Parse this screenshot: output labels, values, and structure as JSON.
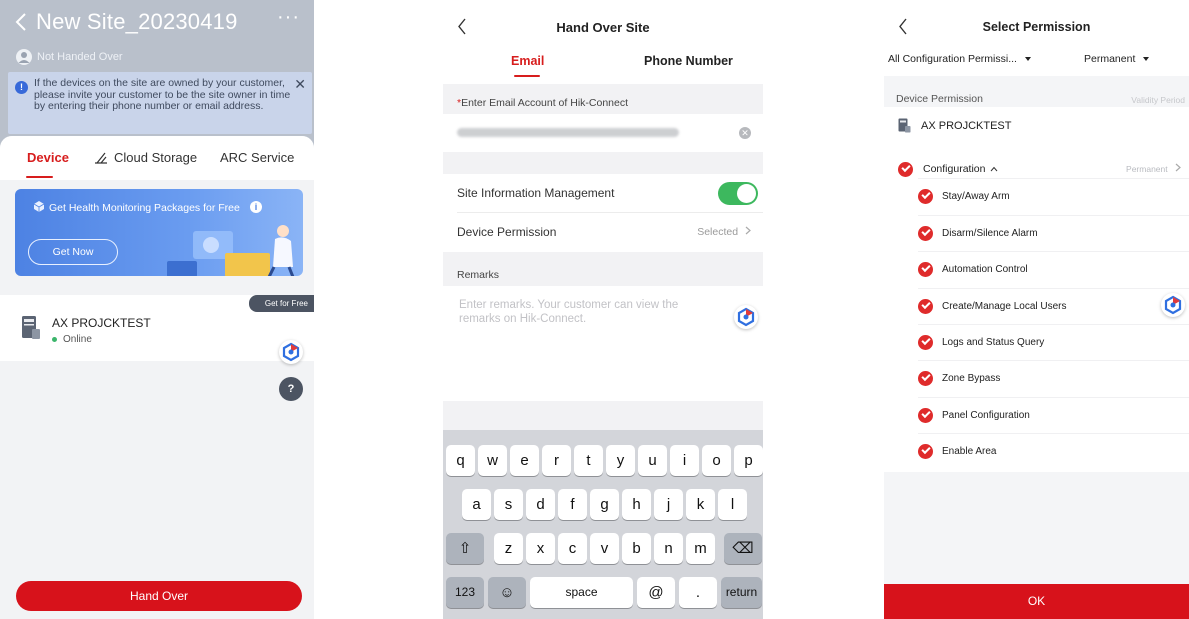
{
  "screen1": {
    "title": "New Site_20230419",
    "more": "···",
    "status": "Not Handed Over",
    "notice": "If the devices on the site are owned by your customer, please invite your customer to be the site owner in time by entering their phone number or email address.",
    "notice_close": "✕",
    "tabs": [
      {
        "label": "Device"
      },
      {
        "label": "Cloud Storage"
      },
      {
        "label": "ARC Service"
      }
    ],
    "banner": {
      "text": "Get Health Monitoring Packages for Free",
      "button": "Get Now",
      "info": "i"
    },
    "device": {
      "name": "AX PROJCKTEST",
      "status": "Online",
      "tag": "Get for Free"
    },
    "help_glyph": "?",
    "hand_over_button": "Hand Over",
    "colors": {
      "primary": "#d7121b",
      "header_overlay": "#b9c0cb",
      "banner": "#4d82e3",
      "online": "#3bb56b"
    }
  },
  "screen2": {
    "title": "Hand Over Site",
    "tabs": [
      {
        "label": "Email"
      },
      {
        "label": "Phone Number"
      }
    ],
    "email_label_required": "*",
    "email_label": "Enter Email Account of Hik-Connect",
    "email_value_blurred": "",
    "clear_glyph": "✕",
    "site_info_label": "Site Information Management",
    "site_info_enabled": true,
    "device_permission_label": "Device Permission",
    "device_permission_value": "Selected",
    "remarks_label": "Remarks",
    "remarks_placeholder": "Enter remarks. Your customer can view the remarks on Hik-Connect.",
    "keyboard": {
      "row1": [
        "q",
        "w",
        "e",
        "r",
        "t",
        "y",
        "u",
        "i",
        "o",
        "p"
      ],
      "row2": [
        "a",
        "s",
        "d",
        "f",
        "g",
        "h",
        "j",
        "k",
        "l"
      ],
      "row3": [
        "z",
        "x",
        "c",
        "v",
        "b",
        "n",
        "m"
      ],
      "shift": "⇧",
      "backspace": "⌫",
      "numbers": "123",
      "emoji": "☺",
      "space": "space",
      "at": "@",
      "dot": ".",
      "return": "return"
    },
    "colors": {
      "accent": "#d71d1d",
      "toggle_on": "#3db85e"
    }
  },
  "screen3": {
    "title": "Select Permission",
    "filter_permission": "All Configuration Permissi...",
    "filter_period": "Permanent",
    "header_left": "Device Permission",
    "header_right": "Validity Period",
    "site_name": "AX PROJCKTEST",
    "group_label": "Configuration",
    "group_value": "Permanent",
    "permissions": [
      {
        "label": "Stay/Away Arm"
      },
      {
        "label": "Disarm/Silence Alarm"
      },
      {
        "label": "Automation Control"
      },
      {
        "label": "Create/Manage Local Users"
      },
      {
        "label": "Logs and Status Query"
      },
      {
        "label": "Zone Bypass"
      },
      {
        "label": "Panel Configuration"
      },
      {
        "label": "Enable Area"
      }
    ],
    "ok_button": "OK",
    "colors": {
      "check": "#df2b2b",
      "ok": "#d7121b"
    }
  }
}
